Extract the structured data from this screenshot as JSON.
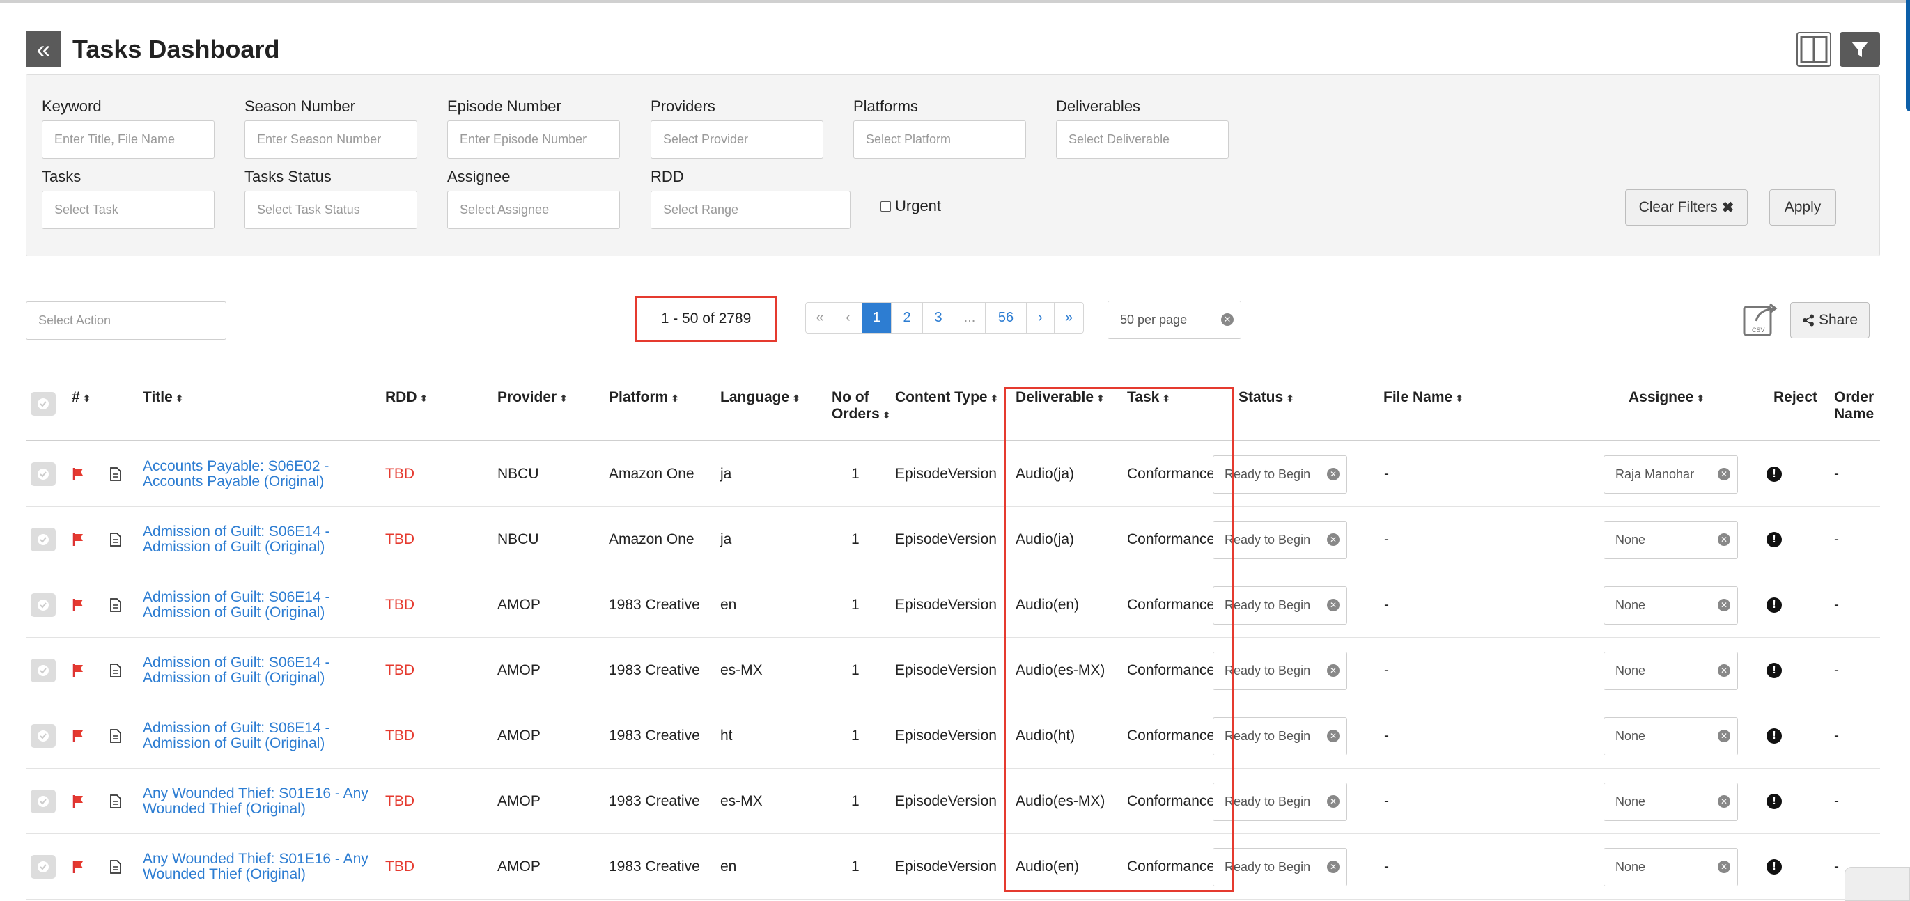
{
  "header": {
    "back_icon": "double-chevron-left-icon",
    "title": "Tasks Dashboard",
    "columns_icon": "columns-icon",
    "filter_icon": "filter-icon"
  },
  "filters": {
    "keyword": {
      "label": "Keyword",
      "placeholder": "Enter Title, File Name"
    },
    "season": {
      "label": "Season Number",
      "placeholder": "Enter Season Number"
    },
    "episode": {
      "label": "Episode Number",
      "placeholder": "Enter Episode Number"
    },
    "providers": {
      "label": "Providers",
      "placeholder": "Select Provider"
    },
    "platforms": {
      "label": "Platforms",
      "placeholder": "Select Platform"
    },
    "deliverables": {
      "label": "Deliverables",
      "placeholder": "Select Deliverable"
    },
    "tasks": {
      "label": "Tasks",
      "placeholder": "Select Task"
    },
    "task_status": {
      "label": "Tasks Status",
      "placeholder": "Select Task Status"
    },
    "assignee": {
      "label": "Assignee",
      "placeholder": "Select Assignee"
    },
    "rdd": {
      "label": "RDD",
      "placeholder": "Select Range"
    },
    "urgent_label": "Urgent",
    "clear_label": "Clear Filters",
    "apply_label": "Apply"
  },
  "toolbar": {
    "select_action_placeholder": "Select Action",
    "range_text": "1 - 50 of 2789",
    "pages": [
      "«",
      "‹",
      "1",
      "2",
      "3",
      "...",
      "56",
      "›",
      "»"
    ],
    "active_page": "1",
    "per_page": "50 per page",
    "csv_icon": "csv-export-icon",
    "share_label": "Share"
  },
  "table": {
    "columns": {
      "num": "#",
      "title": "Title",
      "rdd": "RDD",
      "provider": "Provider",
      "platform": "Platform",
      "language": "Language",
      "orders": "No of Orders",
      "content_type": "Content Type",
      "deliverable": "Deliverable",
      "task": "Task",
      "status": "Status",
      "file_name": "File Name",
      "assignee": "Assignee",
      "reject": "Reject",
      "order_name": "Order Name"
    },
    "rows": [
      {
        "title": "Accounts Payable: S06E02 - Accounts Payable (Original)",
        "rdd": "TBD",
        "provider": "NBCU",
        "platform": "Amazon One",
        "language": "ja",
        "orders": "1",
        "content_type": "EpisodeVersion",
        "deliverable": "Audio(ja)",
        "task": "Conformance",
        "status": "Ready to Begin",
        "file_name": "-",
        "assignee": "Raja Manohar",
        "order_name": "-"
      },
      {
        "title": "Admission of Guilt: S06E14 - Admission of Guilt (Original)",
        "rdd": "TBD",
        "provider": "NBCU",
        "platform": "Amazon One",
        "language": "ja",
        "orders": "1",
        "content_type": "EpisodeVersion",
        "deliverable": "Audio(ja)",
        "task": "Conformance",
        "status": "Ready to Begin",
        "file_name": "-",
        "assignee": "None",
        "order_name": "-"
      },
      {
        "title": "Admission of Guilt: S06E14 - Admission of Guilt (Original)",
        "rdd": "TBD",
        "provider": "AMOP",
        "platform": "1983 Creative",
        "language": "en",
        "orders": "1",
        "content_type": "EpisodeVersion",
        "deliverable": "Audio(en)",
        "task": "Conformance",
        "status": "Ready to Begin",
        "file_name": "-",
        "assignee": "None",
        "order_name": "-"
      },
      {
        "title": "Admission of Guilt: S06E14 - Admission of Guilt (Original)",
        "rdd": "TBD",
        "provider": "AMOP",
        "platform": "1983 Creative",
        "language": "es-MX",
        "orders": "1",
        "content_type": "EpisodeVersion",
        "deliverable": "Audio(es-MX)",
        "task": "Conformance",
        "status": "Ready to Begin",
        "file_name": "-",
        "assignee": "None",
        "order_name": "-"
      },
      {
        "title": "Admission of Guilt: S06E14 - Admission of Guilt (Original)",
        "rdd": "TBD",
        "provider": "AMOP",
        "platform": "1983 Creative",
        "language": "ht",
        "orders": "1",
        "content_type": "EpisodeVersion",
        "deliverable": "Audio(ht)",
        "task": "Conformance",
        "status": "Ready to Begin",
        "file_name": "-",
        "assignee": "None",
        "order_name": "-"
      },
      {
        "title": "Any Wounded Thief: S01E16 - Any Wounded Thief (Original)",
        "rdd": "TBD",
        "provider": "AMOP",
        "platform": "1983 Creative",
        "language": "es-MX",
        "orders": "1",
        "content_type": "EpisodeVersion",
        "deliverable": "Audio(es-MX)",
        "task": "Conformance",
        "status": "Ready to Begin",
        "file_name": "-",
        "assignee": "None",
        "order_name": "-"
      },
      {
        "title": "Any Wounded Thief: S01E16 - Any Wounded Thief (Original)",
        "rdd": "TBD",
        "provider": "AMOP",
        "platform": "1983 Creative",
        "language": "en",
        "orders": "1",
        "content_type": "EpisodeVersion",
        "deliverable": "Audio(en)",
        "task": "Conformance",
        "status": "Ready to Begin",
        "file_name": "-",
        "assignee": "None",
        "order_name": "-"
      }
    ]
  },
  "colors": {
    "accent": "#2d7dd2",
    "danger": "#e53a2f",
    "dark": "#5a5a5a"
  }
}
